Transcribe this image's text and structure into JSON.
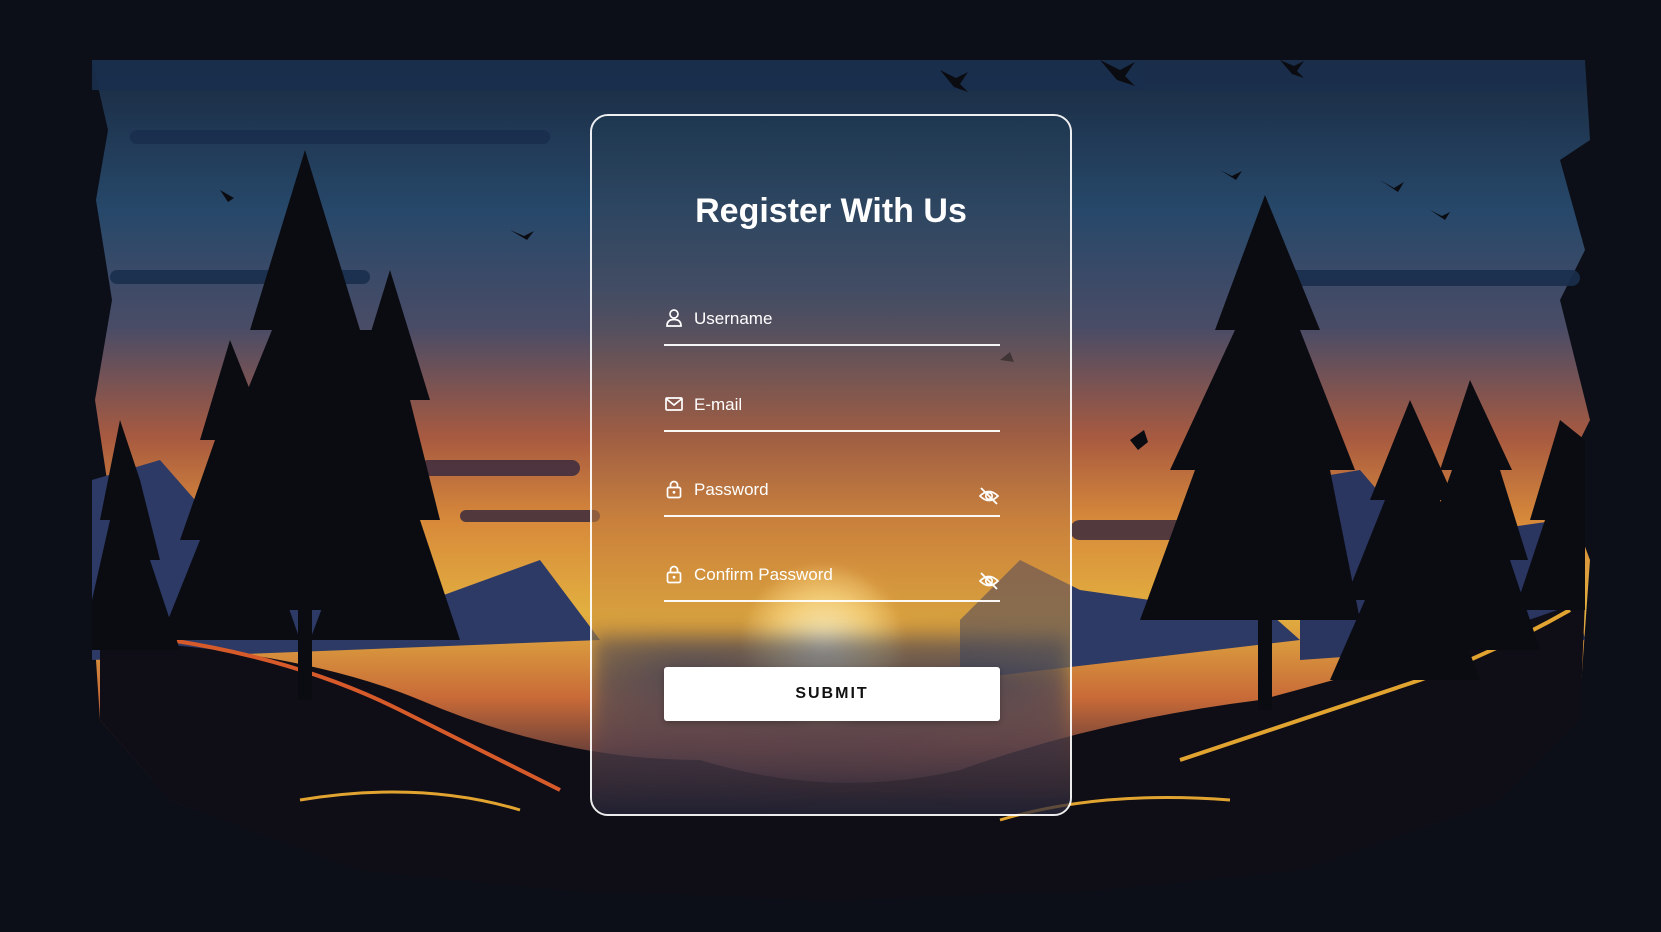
{
  "form": {
    "title": "Register With Us",
    "fields": [
      {
        "icon": "user-icon",
        "placeholder": "Username",
        "value": ""
      },
      {
        "icon": "mail-icon",
        "placeholder": "E-mail",
        "value": ""
      },
      {
        "icon": "lock-icon",
        "placeholder": "Password",
        "value": "",
        "toggle_icon": "eye-off-icon"
      },
      {
        "icon": "lock-icon",
        "placeholder": "Confirm Password",
        "value": "",
        "toggle_icon": "eye-off-icon"
      }
    ],
    "submit_label": "SUBMIT"
  },
  "colors": {
    "page_background": "#0c0f18",
    "text": "#ffffff",
    "card_border": "#ffffff",
    "button_background": "#ffffff",
    "button_text": "#111111"
  }
}
